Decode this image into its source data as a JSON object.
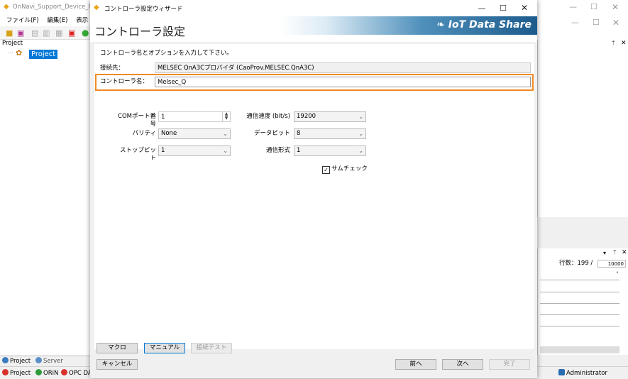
{
  "background_app": {
    "title": "OnNavi_Support_Device_PLC",
    "menu": [
      "ファイル(F)",
      "編集(E)",
      "表示(V"
    ],
    "project_panel_title": "Project",
    "project_node": "Project",
    "bottom_tabs": [
      "Project",
      "Server"
    ],
    "status_items": [
      "Project",
      "ORiN",
      "OPC DA"
    ],
    "status_user": "Administrator",
    "right_panel": {
      "row_count_label": "行数：199 /",
      "row_limit": "10000"
    }
  },
  "dialog": {
    "window_title": "コントローラ設定ウィザード",
    "header_title": "コントローラ設定",
    "brand_logo": "IoT Data Share",
    "instruction": "コントローラ名とオプションを入力して下さい。",
    "connection_label": "接続先：",
    "connection_value": "MELSEC QnA3Cプロバイダ (CaoProv.MELSEC.QnA3C)",
    "controller_name_label": "コントローラ名：",
    "controller_name_value": "Melsec_Q",
    "highlight_color": "#f08a24",
    "options": {
      "com_port_label": "COMポート番号",
      "com_port_value": "1",
      "parity_label": "パリティ",
      "parity_value": "None",
      "stop_bit_label": "ストップビット",
      "stop_bit_value": "1",
      "baud_label": "通信速度 (bit/s)",
      "baud_value": "19200",
      "data_bit_label": "データビット",
      "data_bit_value": "8",
      "comm_format_label": "通信形式",
      "comm_format_value": "1",
      "checksum_label": "サムチェック",
      "checksum_checked": true
    },
    "buttons": {
      "macro": "マクロ",
      "manual": "マニュアル",
      "connection_test": "接続テスト",
      "cancel": "キャンセル",
      "back": "前へ",
      "next": "次へ",
      "finish": "完了"
    }
  }
}
